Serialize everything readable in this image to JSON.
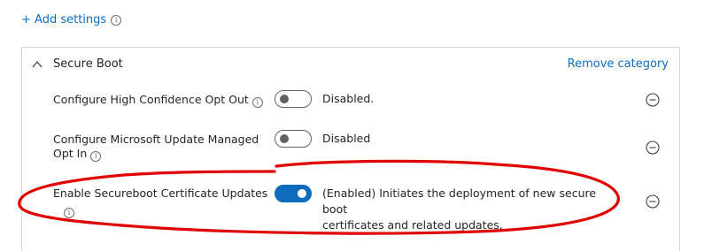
{
  "header": {
    "add_settings_label": "+ Add settings",
    "info_icon": "info-icon"
  },
  "section": {
    "title": "Secure Boot",
    "remove_category_label": "Remove category",
    "expanded": true
  },
  "settings": [
    {
      "label": "Configure High Confidence Opt Out",
      "enabled": false,
      "status": "Disabled."
    },
    {
      "label_line1": "Configure Microsoft Update Managed",
      "label_line2": "Opt In",
      "enabled": false,
      "status": "Disabled"
    },
    {
      "label": "Enable Secureboot Certificate Updates",
      "enabled": true,
      "status_line1": "(Enabled) Initiates the deployment of new secure boot",
      "status_line2": "certificates and related updates."
    }
  ],
  "colors": {
    "link": "#0f6cbd",
    "toggle_on": "#0f6cbd",
    "annotation": "#e00000"
  }
}
